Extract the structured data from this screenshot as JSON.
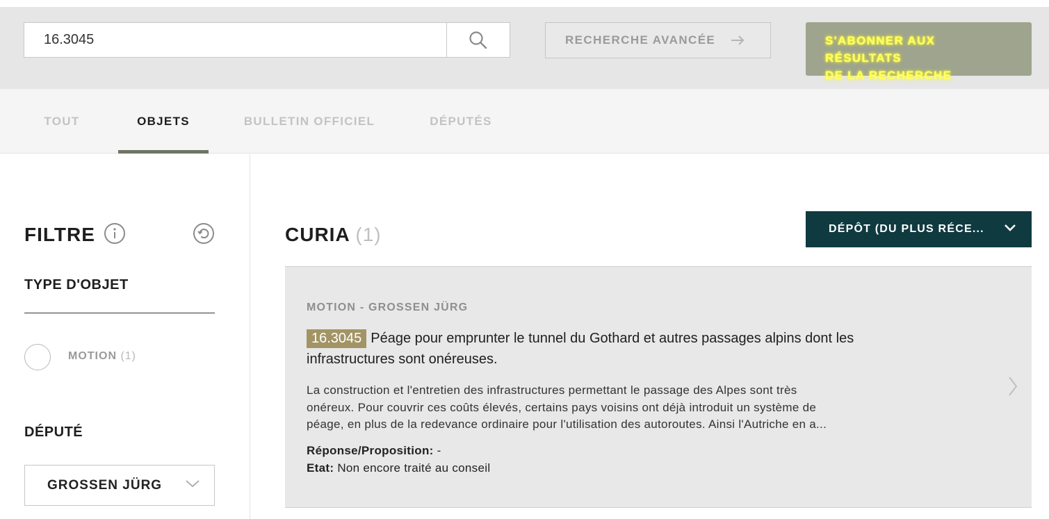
{
  "search": {
    "value": "16.3045",
    "advanced_label": "RECHERCHE AVANCÉE",
    "subscribe_line1": "S'ABONNER AUX RÉSULTATS",
    "subscribe_line2": "DE LA RECHERCHE"
  },
  "tabs": [
    {
      "label": "TOUT",
      "active": false
    },
    {
      "label": "OBJETS",
      "active": true
    },
    {
      "label": "BULLETIN OFFICIEL",
      "active": false
    },
    {
      "label": "DÉPUTÉS",
      "active": false
    }
  ],
  "sidebar": {
    "filter_title": "FILTRE",
    "object_type_title": "TYPE D'OBJET",
    "object_type_option": {
      "label": "MOTION",
      "count": "(1)"
    },
    "deputy_title": "DÉPUTÉ",
    "deputy_selected": "GROSSEN JÜRG"
  },
  "results": {
    "title": "CURIA",
    "count": "(1)",
    "sort_label": "DÉPÔT (DU PLUS RÉCE..."
  },
  "card": {
    "meta": "MOTION - GROSSEN JÜRG",
    "number": "16.3045",
    "title": "Péage pour emprunter le tunnel du Gothard et autres passages alpins dont les infrastructures sont onéreuses.",
    "desc_line1": "La construction et l'entretien des infrastructures permettant le passage des Alpes sont très",
    "desc_line2": "onéreux. Pour couvrir ces coûts élevés, certains pays voisins ont déjà introduit un système de",
    "desc_line3": "péage, en plus de la redevance ordinaire pour l'utilisation des autoroutes. Ainsi l'Autriche en a...",
    "reply_label": "Réponse/Proposition:",
    "reply_value": "-",
    "state_label": "Etat:",
    "state_value": "Non encore traité au conseil"
  },
  "colors": {
    "accent_green": "#6f7564",
    "sort_button": "#0f3a40",
    "badge": "#a39466",
    "subscribe_bg": "#9ea48e",
    "subscribe_text": "#ffff66"
  },
  "icons": {
    "search": "search-icon",
    "arrow": "arrow-right-icon",
    "info": "info-icon",
    "reset": "reset-icon",
    "chevron": "chevron-down-icon",
    "card_arrow": "chevron-right-icon"
  }
}
